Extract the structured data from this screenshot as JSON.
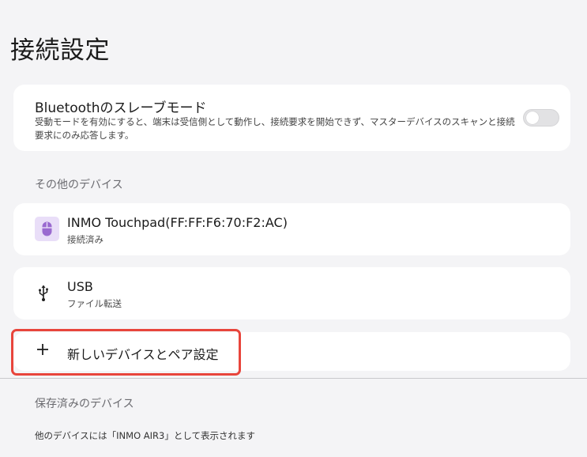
{
  "page": {
    "title": "接続設定"
  },
  "bluetooth_slave": {
    "title": "Bluetoothのスレーブモード",
    "description": "受動モードを有効にすると、端末は受信側として動作し、接続要求を開始できず、マスターデバイスのスキャンと接続要求にのみ応答します。",
    "enabled": false
  },
  "other_devices": {
    "label": "その他のデバイス",
    "items": [
      {
        "name": "INMO Touchpad(FF:FF:F6:70:F2:AC)",
        "status": "接続済み",
        "icon": "mouse-icon"
      },
      {
        "name": "USB",
        "status": "ファイル転送",
        "icon": "usb-icon"
      }
    ]
  },
  "add_device": {
    "label": "新しいデバイスとペア設定",
    "icon": "plus-icon"
  },
  "saved_devices": {
    "label": "保存済みのデバイス",
    "note": "他のデバイスには「INMO AIR3」として表示されます"
  },
  "colors": {
    "background": "#f4f4f6",
    "card": "#ffffff",
    "highlight": "#e8453c",
    "device_icon_bg": "#e9def8",
    "device_icon_fg": "#9a6ad0"
  }
}
